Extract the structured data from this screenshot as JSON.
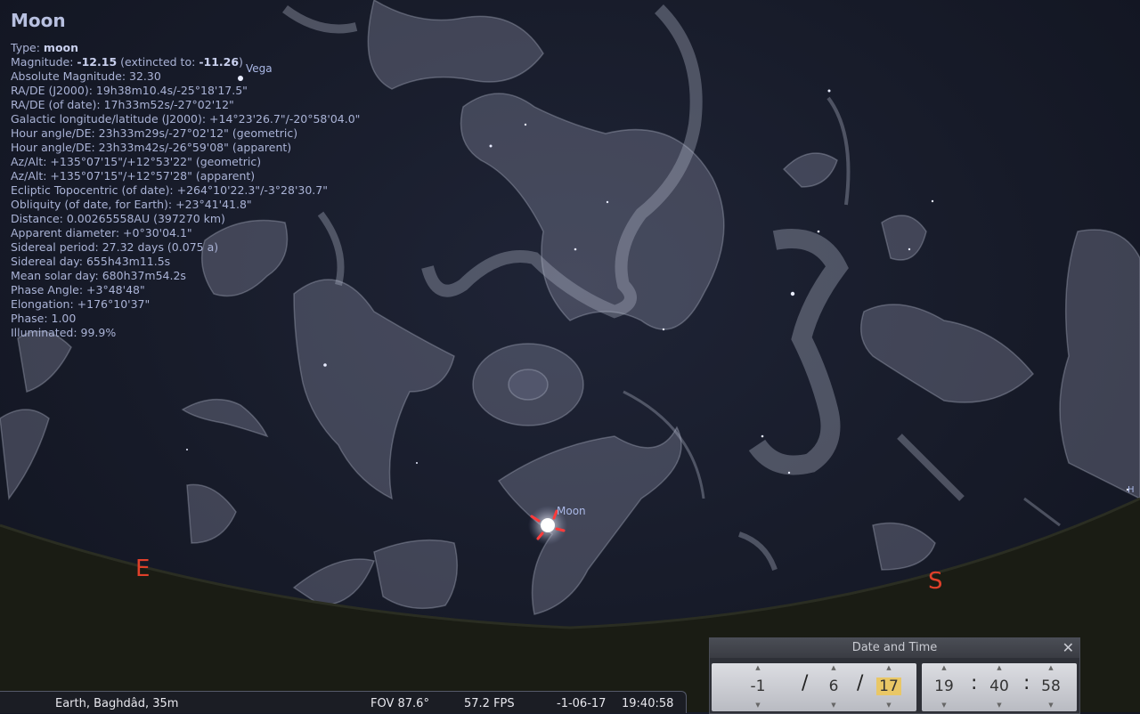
{
  "info": {
    "title": "Moon",
    "type_label": "Type:",
    "type_value": "moon",
    "magnitude_label": "Magnitude:",
    "magnitude_value": "-12.15",
    "magnitude_extinct_label": "(extincted to:",
    "magnitude_extinct_value": "-11.26",
    "magnitude_close": ")",
    "absolute_magnitude": "Absolute Magnitude: 32.30",
    "radec_j2000": "RA/DE (J2000): 19h38m10.4s/-25°18'17.5\"",
    "radec_date": "RA/DE (of date): 17h33m52s/-27°02'12\"",
    "galactic": "Galactic longitude/latitude (J2000): +14°23'26.7\"/-20°58'04.0\"",
    "hour_angle_geo": "Hour angle/DE: 23h33m29s/-27°02'12\" (geometric)",
    "hour_angle_app": "Hour angle/DE: 23h33m42s/-26°59'08\" (apparent)",
    "azalt_geo": "Az/Alt: +135°07'15\"/+12°53'22\" (geometric)",
    "azalt_app": "Az/Alt: +135°07'15\"/+12°57'28\" (apparent)",
    "ecliptic": "Ecliptic Topocentric (of date): +264°10'22.3\"/-3°28'30.7\"",
    "obliquity": "Obliquity (of date, for Earth): +23°41'41.8\"",
    "distance": "Distance: 0.00265558AU (397270 km)",
    "apparent_diameter": "Apparent diameter: +0°30'04.1\"",
    "sidereal_period": "Sidereal period: 27.32 days (0.075 a)",
    "sidereal_day": "Sidereal day: 655h43m11.5s",
    "mean_solar_day": "Mean solar day: 680h37m54.2s",
    "phase_angle": "Phase Angle: +3°48'48\"",
    "elongation": "Elongation: +176°10'37\"",
    "phase": "Phase: 1.00",
    "illuminated": "Illuminated: 99.9%"
  },
  "sky": {
    "vega_label": "Vega",
    "moon_label": "Moon",
    "east": "E",
    "south": "S",
    "edge_label": "H"
  },
  "bottom_bar": {
    "location": "Earth, Baghdâd, 35m",
    "fov": "FOV 87.6°",
    "fps": "57.2 FPS",
    "date": "-1-06-17",
    "time": "19:40:58"
  },
  "datetime_dialog": {
    "title": "Date and Time",
    "close": "✕",
    "year": "-1",
    "month": "6",
    "day": "17",
    "hour": "19",
    "minute": "40",
    "second": "58",
    "date_sep": "/",
    "time_sep": ":",
    "up_arrow": "▲",
    "down_arrow": "▼"
  },
  "colors": {
    "sky": "#171b29",
    "ground": "#1a1c14",
    "cardinal": "#e0402a",
    "moon_marker": "#ff3b3b",
    "highlight": "#e9c766"
  }
}
